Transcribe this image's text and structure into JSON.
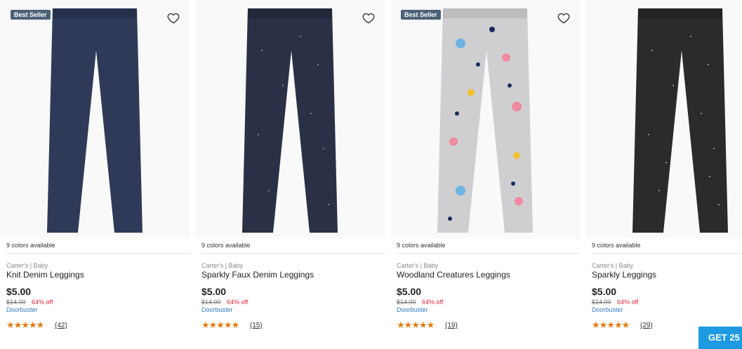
{
  "products": [
    {
      "badge": "Best Seller",
      "colors": "9 colors available",
      "brand": "Carter's | Baby",
      "name": "Knit Denim Leggings",
      "price": "$5.00",
      "original_price": "$14.00",
      "discount": "64% off",
      "deal": "Doorbuster",
      "stars": "★★★★★",
      "reviews": "(42)",
      "icon": "heart-outline-icon",
      "pants_color": "#2f3a58"
    },
    {
      "badge": "",
      "colors": "9 colors available",
      "brand": "Carter's | Baby",
      "name": "Sparkly Faux Denim Leggings",
      "price": "$5.00",
      "original_price": "$14.00",
      "discount": "64% off",
      "deal": "Doorbuster",
      "stars": "★★★★★",
      "reviews": "(15)",
      "icon": "heart-outline-icon",
      "pants_color": "#2a3046"
    },
    {
      "badge": "Best Seller",
      "colors": "9 colors available",
      "brand": "Carter's | Baby",
      "name": "Woodland Creatures Leggings",
      "price": "$5.00",
      "original_price": "$14.00",
      "discount": "64% off",
      "deal": "Doorbuster",
      "stars": "★★★★★",
      "reviews": "(19)",
      "icon": "heart-outline-icon",
      "pants_color": "#cfcfd1"
    },
    {
      "badge": "",
      "colors": "9 colors available",
      "brand": "Carter's | Baby",
      "name": "Sparkly Leggings",
      "price": "$5.00",
      "original_price": "$14.00",
      "discount": "64% off",
      "deal": "Doorbuster",
      "stars": "★★★★★",
      "reviews": "(29)",
      "icon": "heart-outline-icon",
      "pants_color": "#2b2b2b"
    }
  ],
  "cta": {
    "label": "GET 25"
  },
  "colors": {
    "badge_bg": "#4b6278",
    "star": "#e17c14",
    "discount": "#d9263a",
    "deal": "#2f7bbd",
    "cta_bg": "#1e9be0"
  }
}
